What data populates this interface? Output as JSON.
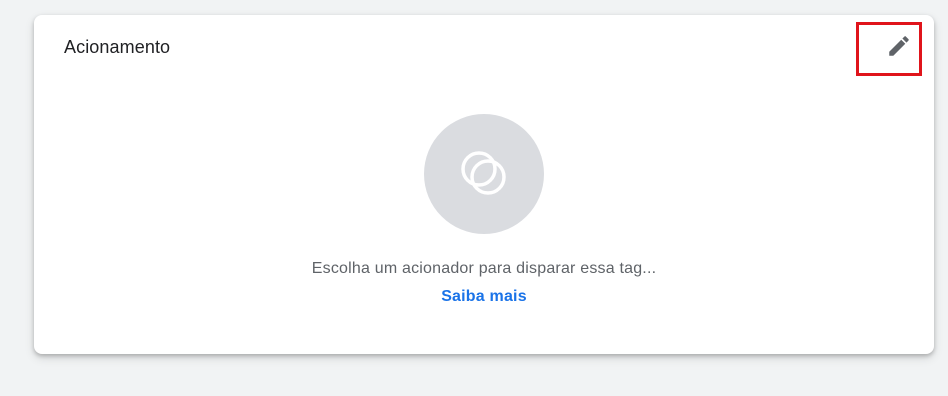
{
  "card": {
    "title": "Acionamento",
    "edit_icon": "pencil-icon",
    "highlight_color": "#e0141b"
  },
  "empty_state": {
    "icon": "overlapping-circles-icon",
    "message": "Escolha um acionador para disparar essa tag...",
    "link_label": "Saiba mais",
    "link_color": "#1a73e8"
  }
}
